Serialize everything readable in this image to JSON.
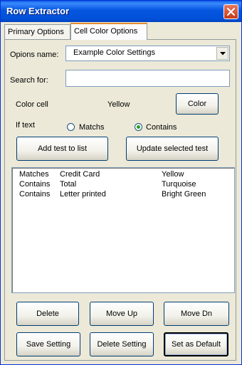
{
  "window": {
    "title": "Row Extractor"
  },
  "tabs": [
    {
      "label": "Primary Options"
    },
    {
      "label": "Cell Color Options"
    }
  ],
  "options_name": {
    "label": "Opions name:",
    "value": "Example Color Settings"
  },
  "search": {
    "label": "Search for:",
    "value": "",
    "placeholder": ""
  },
  "color_cell": {
    "label": "Color cell",
    "value": "Yellow",
    "button": "Color"
  },
  "if_text": {
    "label": "If text",
    "matches_label": "Matchs",
    "contains_label": "Contains",
    "selected": "Contains"
  },
  "actions": {
    "add_test": "Add test to list",
    "update_test": "Update selected test"
  },
  "tests": [
    {
      "mode": "Matches",
      "text": "Credit Card",
      "color": "Yellow"
    },
    {
      "mode": "Contains",
      "text": "Total",
      "color": "Turquoise"
    },
    {
      "mode": "Contains",
      "text": "Letter printed",
      "color": "Bright Green"
    }
  ],
  "buttons": {
    "delete": "Delete",
    "move_up": "Move Up",
    "move_down": "Move Dn",
    "save_setting": "Save Setting",
    "delete_setting": "Delete Setting",
    "set_default": "Set as Default"
  },
  "icons": {
    "close": "close-icon",
    "dropdown": "chevron-down-icon"
  },
  "colors": {
    "titlebar": "#0556e0",
    "dialog": "#ece9d8",
    "active_tab_accent": "#e68b2c",
    "close_button": "#c43b1a"
  }
}
